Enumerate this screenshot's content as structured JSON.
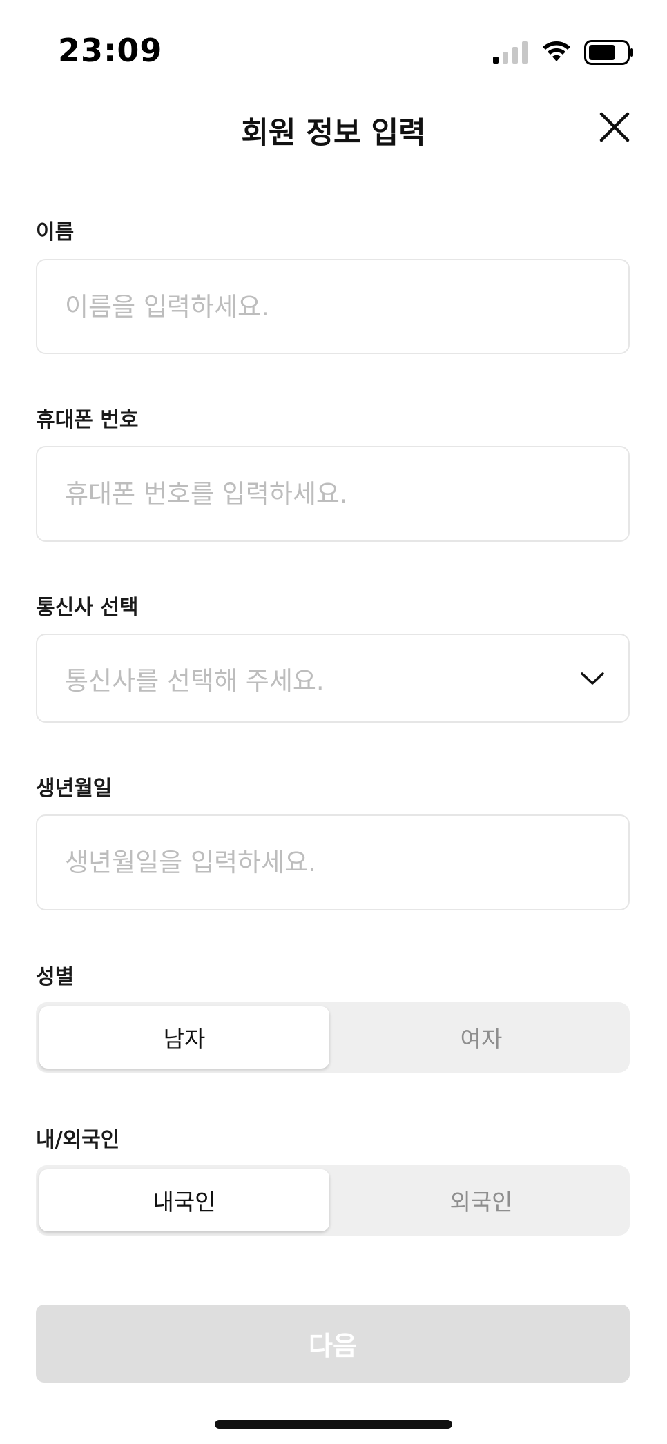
{
  "status_bar": {
    "time": "23:09",
    "icons": [
      "cellular-signal-icon",
      "wifi-icon",
      "battery-icon"
    ]
  },
  "header": {
    "title": "회원 정보 입력",
    "close_icon": "close-icon"
  },
  "form": {
    "name": {
      "label": "이름",
      "placeholder": "이름을 입력하세요.",
      "value": ""
    },
    "phone": {
      "label": "휴대폰 번호",
      "placeholder": "휴대폰 번호를 입력하세요.",
      "value": ""
    },
    "carrier": {
      "label": "통신사 선택",
      "placeholder": "통신사를 선택해 주세요.",
      "icon": "chevron-down-icon"
    },
    "birthdate": {
      "label": "생년월일",
      "placeholder": "생년월일을 입력하세요.",
      "value": ""
    },
    "gender": {
      "label": "성별",
      "options": [
        "남자",
        "여자"
      ],
      "selected": "남자"
    },
    "nationality": {
      "label": "내/외국인",
      "options": [
        "내국인",
        "외국인"
      ],
      "selected": "내국인"
    }
  },
  "next_button": {
    "label": "다음",
    "enabled": false
  },
  "colors": {
    "placeholder": "#bdbdbd",
    "border": "#e6e6e6",
    "segment_bg": "#efefef",
    "disabled_button": "#dedede",
    "text": "#111111"
  }
}
